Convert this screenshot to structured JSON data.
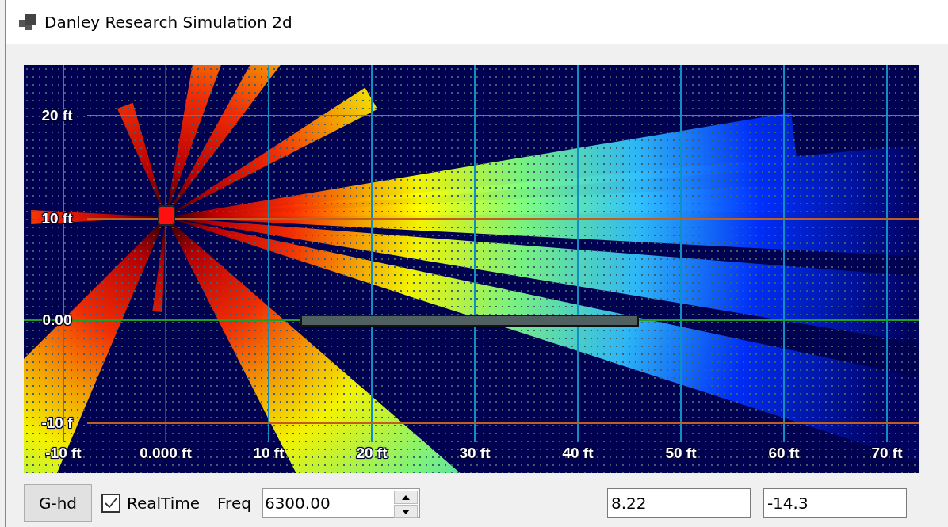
{
  "window": {
    "title": "Danley Research Simulation 2d"
  },
  "plot": {
    "y_labels": [
      "20 ft",
      "10 ft",
      "0.00",
      "-10 f"
    ],
    "x_labels": [
      "-10 ft",
      "0.000 ft",
      "10 ft",
      "20 ft",
      "30 ft",
      "40 ft",
      "50 ft",
      "60 ft",
      "70 ft"
    ]
  },
  "controls": {
    "button": "G-hd",
    "realtime": {
      "label": "RealTime",
      "checked": true
    },
    "freq": {
      "label": "Freq",
      "value": "6300.00"
    },
    "fields": [
      "8.22",
      "-14.3"
    ]
  }
}
